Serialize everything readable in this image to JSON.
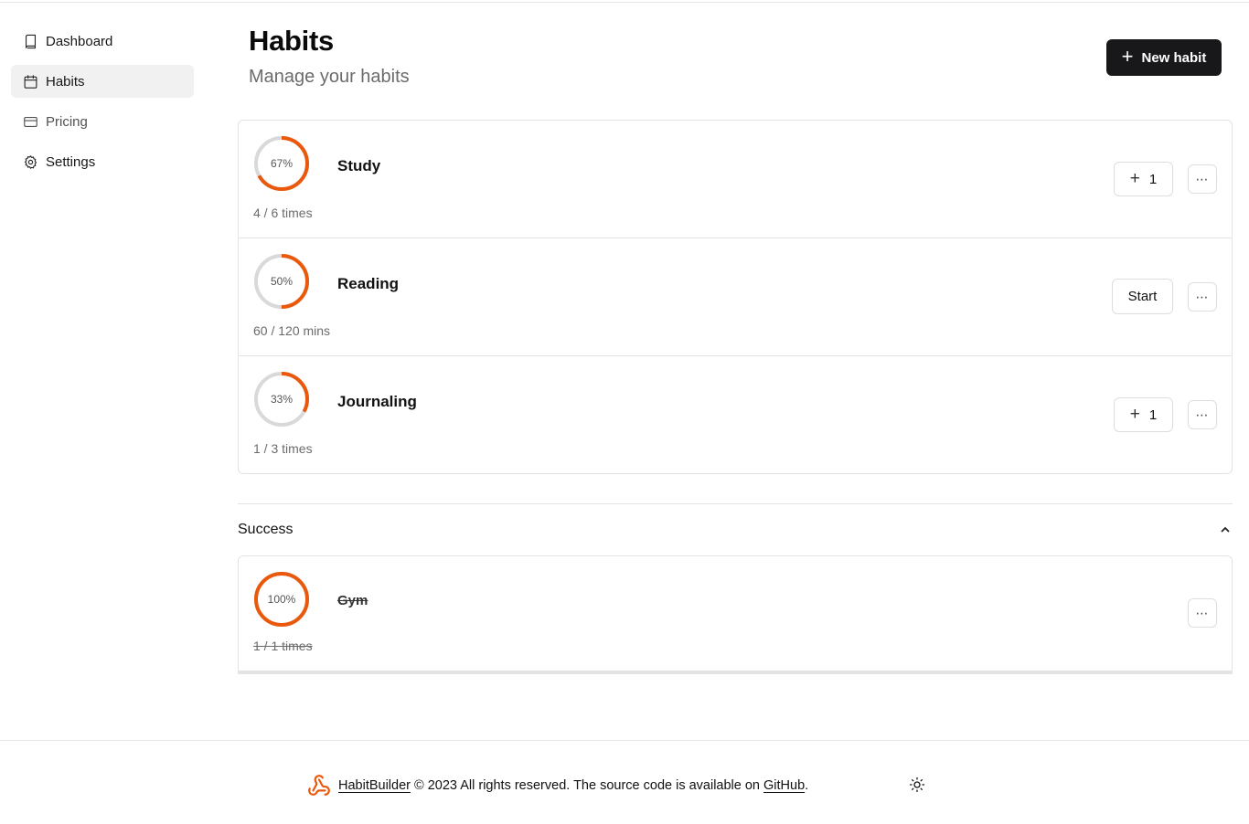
{
  "sidebar": {
    "items": [
      {
        "label": "Dashboard",
        "icon": "book-icon",
        "active": false
      },
      {
        "label": "Habits",
        "icon": "calendar-icon",
        "active": true
      },
      {
        "label": "Pricing",
        "icon": "credit-card-icon",
        "active": false
      },
      {
        "label": "Settings",
        "icon": "gear-icon",
        "active": false
      }
    ]
  },
  "header": {
    "title": "Habits",
    "subtitle": "Manage your habits",
    "new_habit_label": "New habit"
  },
  "habits": [
    {
      "name": "Study",
      "percent_label": "67%",
      "progress": 0.67,
      "progress_text": "4 / 6 times",
      "action": "+ 1",
      "action_label": "1",
      "more_label": "⋯"
    },
    {
      "name": "Reading",
      "percent_label": "50%",
      "progress": 0.5,
      "progress_text": "60 / 120 mins",
      "action": "Start",
      "action_label": "Start",
      "more_label": "⋯"
    },
    {
      "name": "Journaling",
      "percent_label": "33%",
      "progress": 0.33,
      "progress_text": "1 / 3 times",
      "action": "+ 1",
      "action_label": "1",
      "more_label": "⋯"
    }
  ],
  "success": {
    "title": "Success",
    "habits": [
      {
        "name": "Gym",
        "percent_label": "100%",
        "progress": 1.0,
        "progress_text": "1 / 1 times",
        "more_label": "⋯"
      }
    ]
  },
  "footer": {
    "brand": "HabitBuilder",
    "copyright_text": " © 2023 All rights reserved. The source code is available on ",
    "github_label": "GitHub",
    "period": "."
  },
  "colors": {
    "accent": "#ea580c",
    "ring_track": "#d9d9d9",
    "primary_button": "#18181b"
  }
}
